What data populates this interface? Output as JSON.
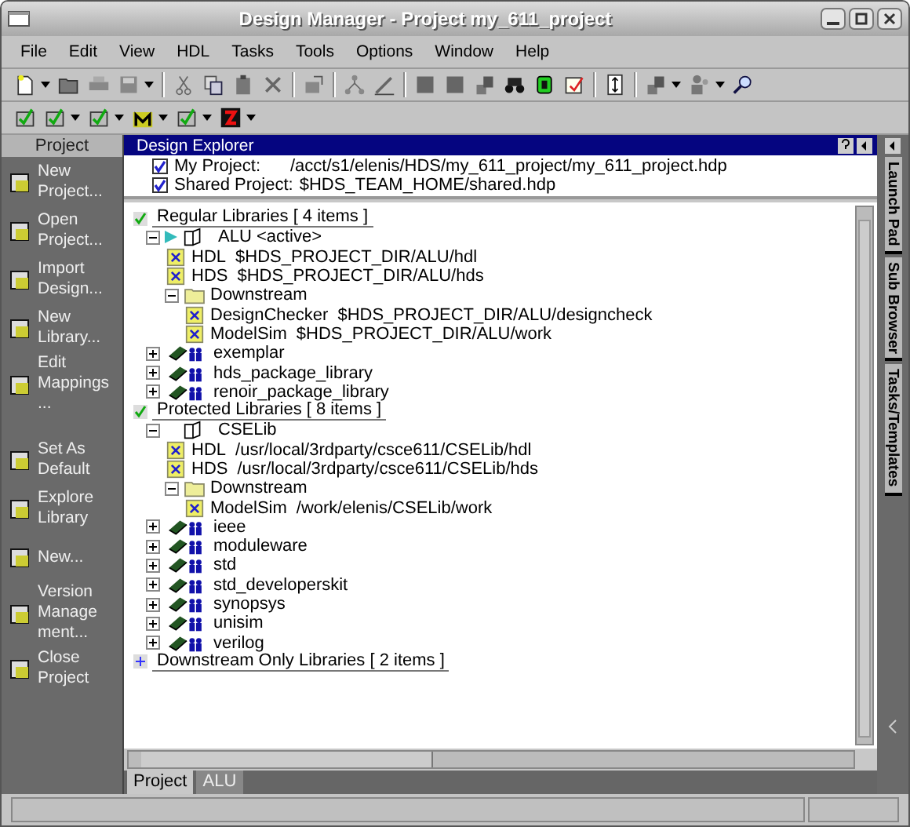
{
  "window": {
    "title": "Design Manager - Project my_611_project"
  },
  "menu": [
    "File",
    "Edit",
    "View",
    "HDL",
    "Tasks",
    "Tools",
    "Options",
    "Window",
    "Help"
  ],
  "shortcut_bar": {
    "title": "Project",
    "items": [
      {
        "label": "New Project..."
      },
      {
        "label": "Open Project..."
      },
      {
        "label": "Import Design..."
      },
      {
        "label": "New Library..."
      },
      {
        "label": "Edit Mappings..."
      },
      {
        "label": "Set As Default"
      },
      {
        "label": "Explore Library"
      },
      {
        "label": "New..."
      },
      {
        "label": "Version Management..."
      },
      {
        "label": "Close Project"
      }
    ]
  },
  "explorer": {
    "title": "Design Explorer",
    "projects": [
      {
        "label": "My Project:",
        "path": "/acct/s1/elenis/HDS/my_611_project/my_611_project.hdp",
        "checked": true
      },
      {
        "label": "Shared Project:",
        "path": "$HDS_TEAM_HOME/shared.hdp",
        "checked": true
      }
    ],
    "tree": [
      {
        "kind": "section",
        "label": "Regular Libraries [ 4 items ]",
        "expanded": true,
        "children": [
          {
            "kind": "open_library",
            "label": "ALU <active>",
            "expanded": true,
            "default": true,
            "children": [
              {
                "kind": "mapping",
                "name": "HDL",
                "path": "$HDS_PROJECT_DIR/ALU/hdl"
              },
              {
                "kind": "mapping",
                "name": "HDS",
                "path": "$HDS_PROJECT_DIR/ALU/hds"
              },
              {
                "kind": "folder",
                "label": "Downstream",
                "expanded": true,
                "children": [
                  {
                    "kind": "mapping",
                    "name": "DesignChecker",
                    "path": "$HDS_PROJECT_DIR/ALU/designcheck"
                  },
                  {
                    "kind": "mapping",
                    "name": "ModelSim",
                    "path": "$HDS_PROJECT_DIR/ALU/work"
                  }
                ]
              }
            ]
          },
          {
            "kind": "library",
            "label": "exemplar",
            "expanded": false
          },
          {
            "kind": "library",
            "label": "hds_package_library",
            "expanded": false
          },
          {
            "kind": "library",
            "label": "renoir_package_library",
            "expanded": false
          }
        ]
      },
      {
        "kind": "section",
        "label": "Protected Libraries [ 8 items ]",
        "expanded": true,
        "children": [
          {
            "kind": "open_library",
            "label": "CSELib",
            "expanded": true,
            "default": false,
            "children": [
              {
                "kind": "mapping",
                "name": "HDL",
                "path": "/usr/local/3rdparty/csce611/CSELib/hdl"
              },
              {
                "kind": "mapping",
                "name": "HDS",
                "path": "/usr/local/3rdparty/csce611/CSELib/hds"
              },
              {
                "kind": "folder",
                "label": "Downstream",
                "expanded": true,
                "children": [
                  {
                    "kind": "mapping",
                    "name": "ModelSim",
                    "path": "/work/elenis/CSELib/work"
                  }
                ]
              }
            ]
          },
          {
            "kind": "library",
            "label": "ieee",
            "expanded": false
          },
          {
            "kind": "library",
            "label": "moduleware",
            "expanded": false
          },
          {
            "kind": "library",
            "label": "std",
            "expanded": false
          },
          {
            "kind": "library",
            "label": "std_developerskit",
            "expanded": false
          },
          {
            "kind": "library",
            "label": "synopsys",
            "expanded": false
          },
          {
            "kind": "library",
            "label": "unisim",
            "expanded": false
          },
          {
            "kind": "library",
            "label": "verilog",
            "expanded": false
          }
        ]
      },
      {
        "kind": "section",
        "label": "Downstream Only Libraries [ 2 items ]",
        "expanded": false
      }
    ],
    "tabs": [
      {
        "label": "Project",
        "selected": true
      },
      {
        "label": "ALU",
        "selected": false
      }
    ]
  },
  "side_tabs": [
    "Launch Pad",
    "Sub Browser",
    "Tasks/Templates"
  ]
}
